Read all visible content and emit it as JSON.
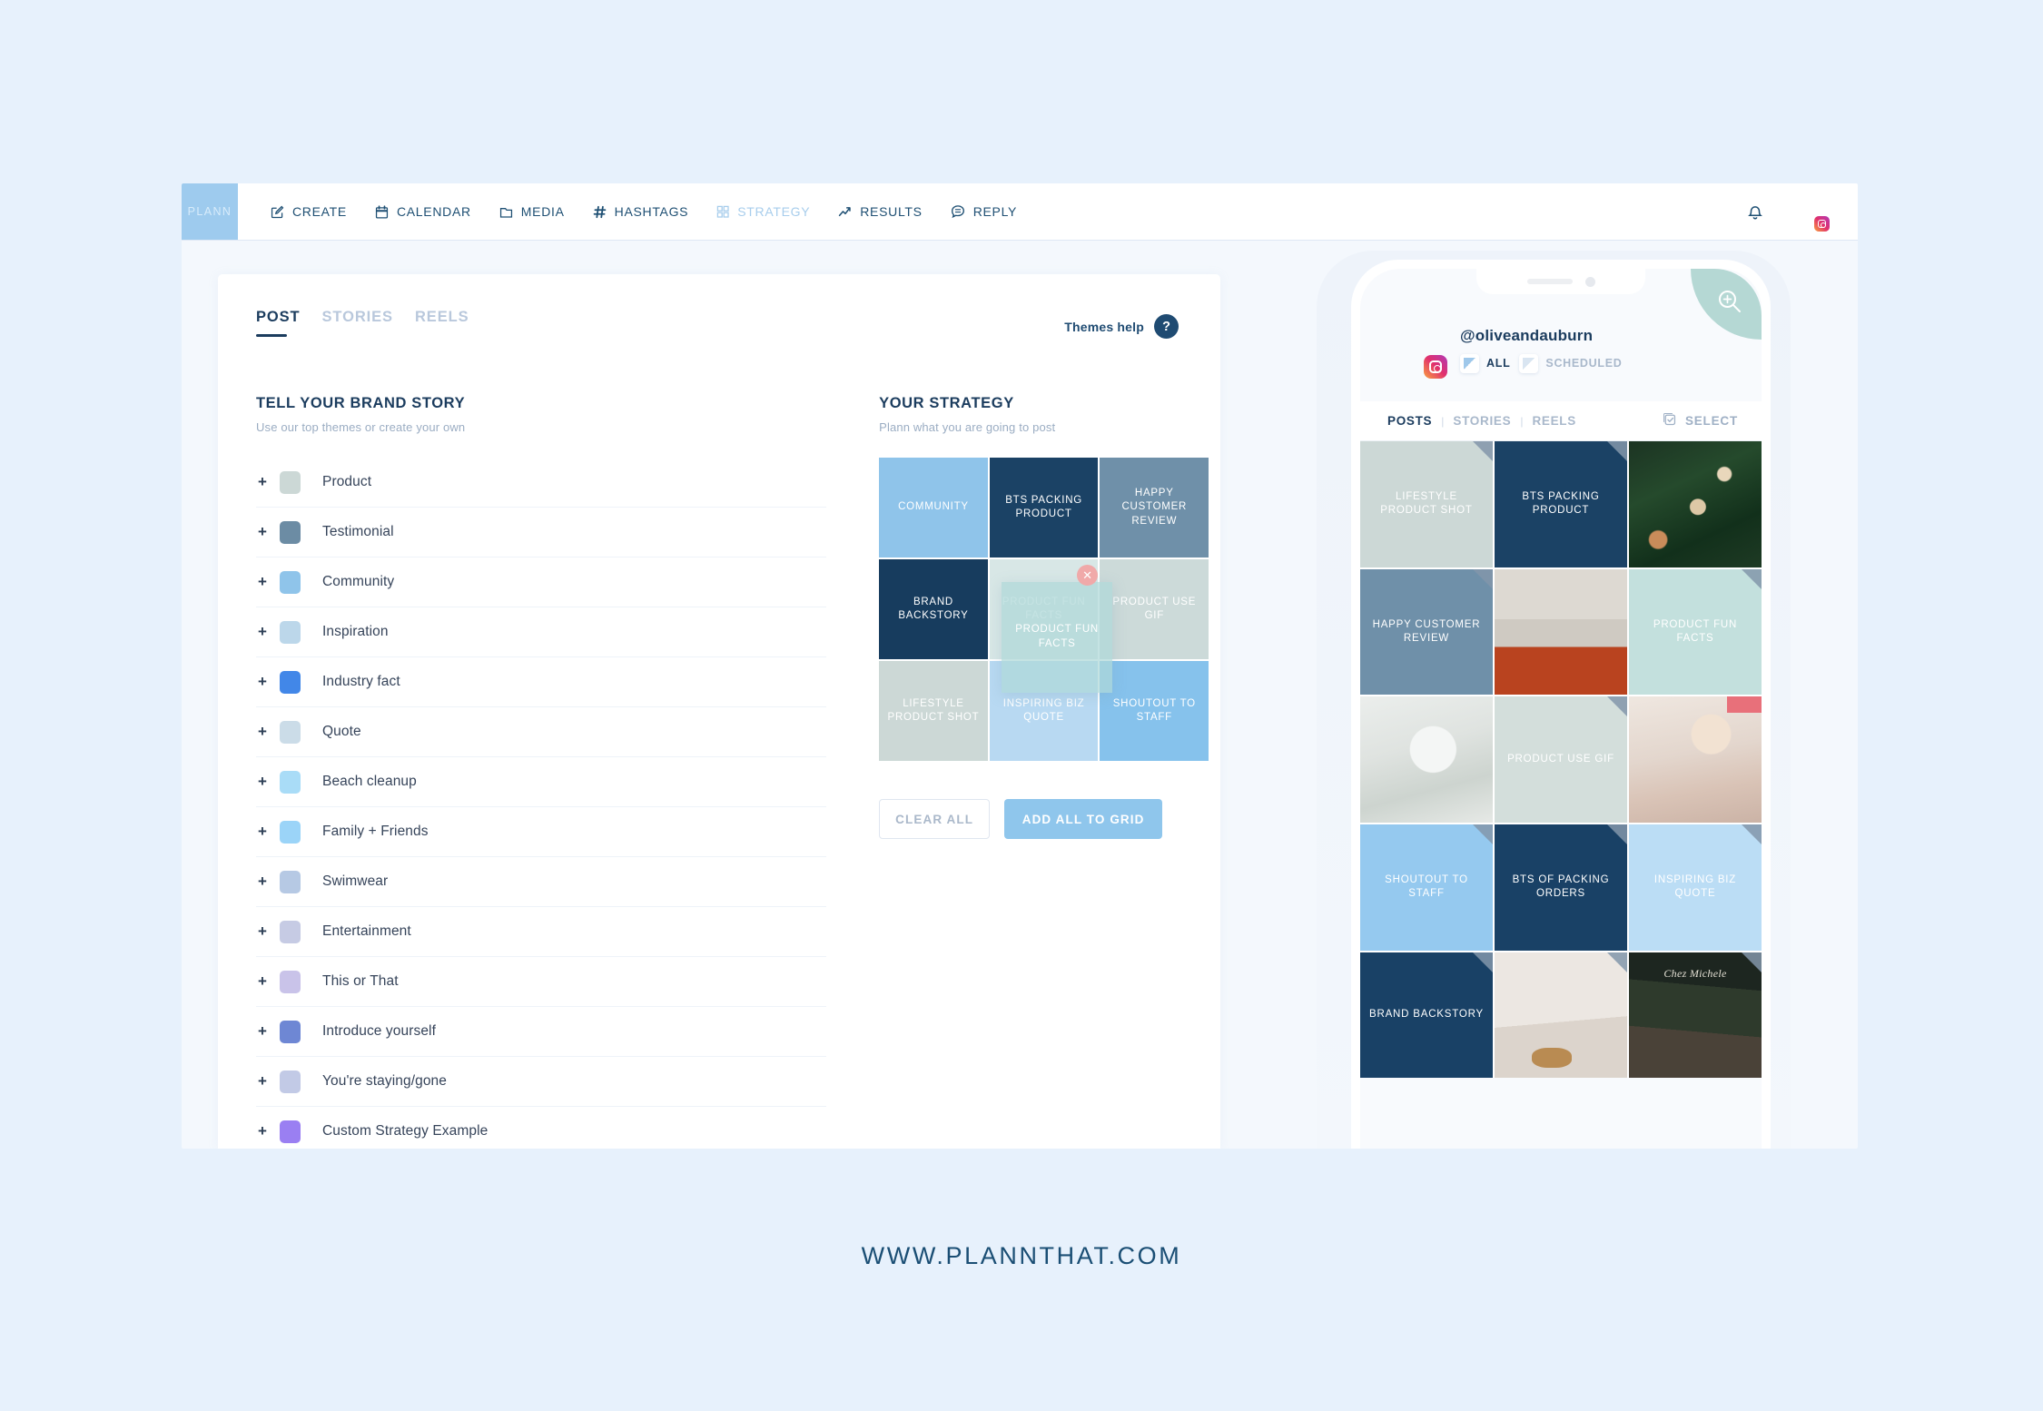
{
  "brand": {
    "logo": "PLANN",
    "footer_url": "WWW.PLANNTHAT.COM"
  },
  "topnav": {
    "items": [
      {
        "label": "CREATE",
        "icon": "pencil-square-icon",
        "active": false
      },
      {
        "label": "CALENDAR",
        "icon": "calendar-icon",
        "active": false
      },
      {
        "label": "MEDIA",
        "icon": "folder-icon",
        "active": false
      },
      {
        "label": "HASHTAGS",
        "icon": "hash-icon",
        "active": false
      },
      {
        "label": "STRATEGY",
        "icon": "grid-icon",
        "active": true
      },
      {
        "label": "RESULTS",
        "icon": "trend-up-icon",
        "active": false
      },
      {
        "label": "REPLY",
        "icon": "chat-bubble-icon",
        "active": false
      }
    ],
    "notifications_icon": "bell-icon",
    "avatar_icon": "user-avatar",
    "avatar_badge_icon": "instagram-icon"
  },
  "content_tabs": [
    {
      "label": "POST",
      "active": true
    },
    {
      "label": "STORIES",
      "active": false
    },
    {
      "label": "REELS",
      "active": false
    }
  ],
  "themes_help": {
    "label": "Themes help",
    "icon": "question-mark-icon"
  },
  "brand_story": {
    "title": "TELL YOUR BRAND STORY",
    "subtitle": "Use our top themes or create your own",
    "add_icon": "plus-icon",
    "themes": [
      {
        "label": "Product",
        "color": "#ccd8d6"
      },
      {
        "label": "Testimonial",
        "color": "#6c8ca4"
      },
      {
        "label": "Community",
        "color": "#8fc4ea"
      },
      {
        "label": "Inspiration",
        "color": "#bcd7ea"
      },
      {
        "label": "Industry fact",
        "color": "#4287e8"
      },
      {
        "label": "Quote",
        "color": "#cbdce8"
      },
      {
        "label": "Beach cleanup",
        "color": "#a9dcf7"
      },
      {
        "label": "Family + Friends",
        "color": "#9bd4f8"
      },
      {
        "label": "Swimwear",
        "color": "#b6c9e4"
      },
      {
        "label": "Entertainment",
        "color": "#c6cbe4"
      },
      {
        "label": "This or That",
        "color": "#c9c3e9"
      },
      {
        "label": "Introduce yourself",
        "color": "#6e87d4"
      },
      {
        "label": "You're staying/gone",
        "color": "#c2cae6"
      },
      {
        "label": "Custom Strategy Example",
        "color": "#9a7ff2"
      }
    ]
  },
  "strategy": {
    "title": "YOUR STRATEGY",
    "subtitle": "Plann what you are going to post",
    "cells": [
      {
        "label": "COMMUNITY",
        "color": "#8fc4ea"
      },
      {
        "label": "BTS PACKING PRODUCT",
        "color": "#1b4265"
      },
      {
        "label": "HAPPY CUSTOMER REVIEW",
        "color": "#6f90a9"
      },
      {
        "label": "BRAND BACKSTORY",
        "color": "#173c5e"
      },
      {
        "label": "PRODUCT FUN FACTS",
        "color": "#d8e7e6"
      },
      {
        "label": "PRODUCT USE GIF",
        "color": "#ccdad9"
      },
      {
        "label": "LIFESTYLE PRODUCT SHOT",
        "color": "#ccd8d6"
      },
      {
        "label": "INSPIRING BIZ QUOTE",
        "color": "#b8d9f2"
      },
      {
        "label": "SHOUTOUT TO STAFF",
        "color": "#86c2ec"
      }
    ],
    "dragging": {
      "label": "PRODUCT FUN FACTS",
      "color": "#afd8d8",
      "close_icon": "close-icon"
    },
    "buttons": {
      "clear": "CLEAR ALL",
      "add": "ADD ALL TO GRID"
    }
  },
  "phone": {
    "zoom_icon": "zoom-in-icon",
    "handle": "@oliveandauburn",
    "filters": [
      {
        "label": "ALL",
        "active": true
      },
      {
        "label": "SCHEDULED",
        "active": false
      }
    ],
    "tabs": [
      {
        "label": "POSTS",
        "active": true
      },
      {
        "label": "STORIES",
        "active": false
      },
      {
        "label": "REELS",
        "active": false
      }
    ],
    "separator": "|",
    "select": {
      "label": "SELECT",
      "icon": "checkbox-square-icon"
    },
    "grid": [
      {
        "type": "theme",
        "label": "LIFESTYLE PRODUCT SHOT",
        "color": "#ccd8d6"
      },
      {
        "type": "theme",
        "label": "BTS PACKING PRODUCT",
        "color": "#1b4265"
      },
      {
        "type": "photo",
        "label": "",
        "photo": "christmas-baubles"
      },
      {
        "type": "theme",
        "label": "HAPPY CUSTOMER REVIEW",
        "color": "#6f90a9"
      },
      {
        "type": "photo",
        "label": "",
        "photo": "mantel-stockings"
      },
      {
        "type": "theme",
        "label": "PRODUCT FUN FACTS",
        "color": "#c3e0dd"
      },
      {
        "type": "photo",
        "label": "",
        "photo": "white-christmas-tree"
      },
      {
        "type": "theme",
        "label": "PRODUCT USE GIF",
        "color": "#d3dedb"
      },
      {
        "type": "photo",
        "label": "",
        "photo": "woman-reading-coffee"
      },
      {
        "type": "theme",
        "label": "SHOUTOUT TO STAFF",
        "color": "#95c9ef"
      },
      {
        "type": "theme",
        "label": "BTS OF PACKING ORDERS",
        "color": "#194166"
      },
      {
        "type": "theme",
        "label": "INSPIRING BIZ QUOTE",
        "color": "#bbddf5"
      },
      {
        "type": "theme",
        "label": "BRAND BACKSTORY",
        "color": "#194166"
      },
      {
        "type": "photo",
        "label": "",
        "photo": "pinecones-still-life"
      },
      {
        "type": "photo",
        "label": "",
        "photo": "chez-michele-shopfront"
      }
    ]
  }
}
